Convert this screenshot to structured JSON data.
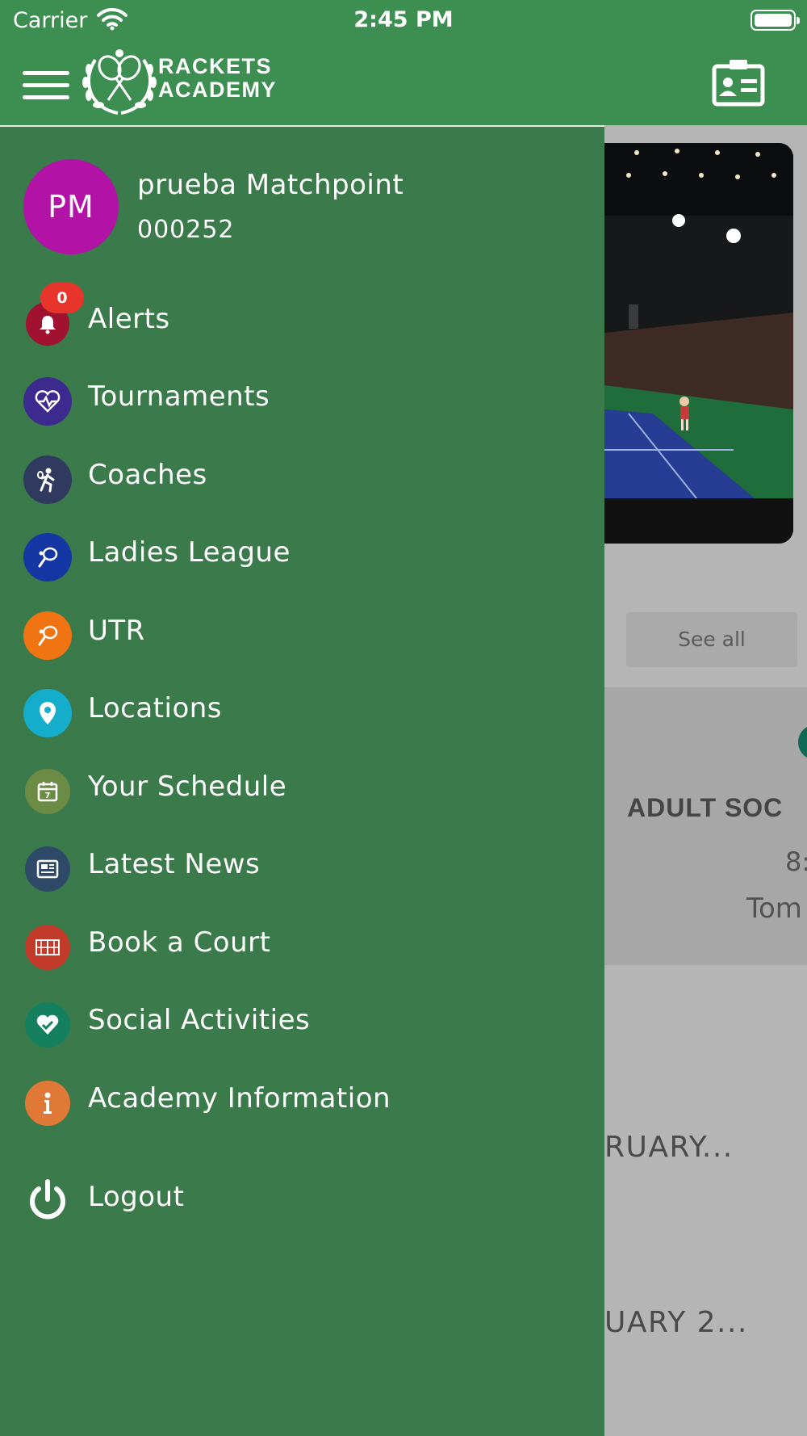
{
  "status_bar": {
    "carrier": "Carrier",
    "time": "2:45 PM"
  },
  "header": {
    "brand_line1": "RACKETS",
    "brand_line2": "ACADEMY"
  },
  "user": {
    "initials": "PM",
    "name": "prueba Matchpoint",
    "id": "000252"
  },
  "menu": {
    "items": [
      {
        "label": "Alerts",
        "icon": "bell-icon",
        "color": "#a0122f",
        "badge": "0"
      },
      {
        "label": "Tournaments",
        "icon": "heartbeat-icon",
        "color": "#3d2a8e"
      },
      {
        "label": "Coaches",
        "icon": "tennis-player-icon",
        "color": "#2f3a5e"
      },
      {
        "label": "Ladies League",
        "icon": "racket-icon",
        "color": "#1537a3"
      },
      {
        "label": "UTR",
        "icon": "racket-icon",
        "color": "#f07412"
      },
      {
        "label": "Locations",
        "icon": "map-pin-icon",
        "color": "#14adcb"
      },
      {
        "label": "Your Schedule",
        "icon": "calendar-icon",
        "color": "#6c8c46"
      },
      {
        "label": "Latest News",
        "icon": "newspaper-icon",
        "color": "#2f4a68"
      },
      {
        "label": "Book a Court",
        "icon": "court-icon",
        "color": "#c13a2a"
      },
      {
        "label": "Social Activities",
        "icon": "heart-check-icon",
        "color": "#15805e"
      },
      {
        "label": "Academy Information",
        "icon": "info-icon",
        "color": "#e07936"
      }
    ],
    "logout": {
      "label": "Logout",
      "icon": "power-icon"
    }
  },
  "background": {
    "see_all": "See all",
    "event_title": "ADULT SOC",
    "event_time": "8:",
    "event_who": "Tom",
    "line1": "RUARY...",
    "line2": "UARY 2..."
  },
  "colors": {
    "header_green": "#3c8f50",
    "drawer_green": "#3b7b4b",
    "avatar": "#b212a6",
    "badge": "#e8352c"
  }
}
